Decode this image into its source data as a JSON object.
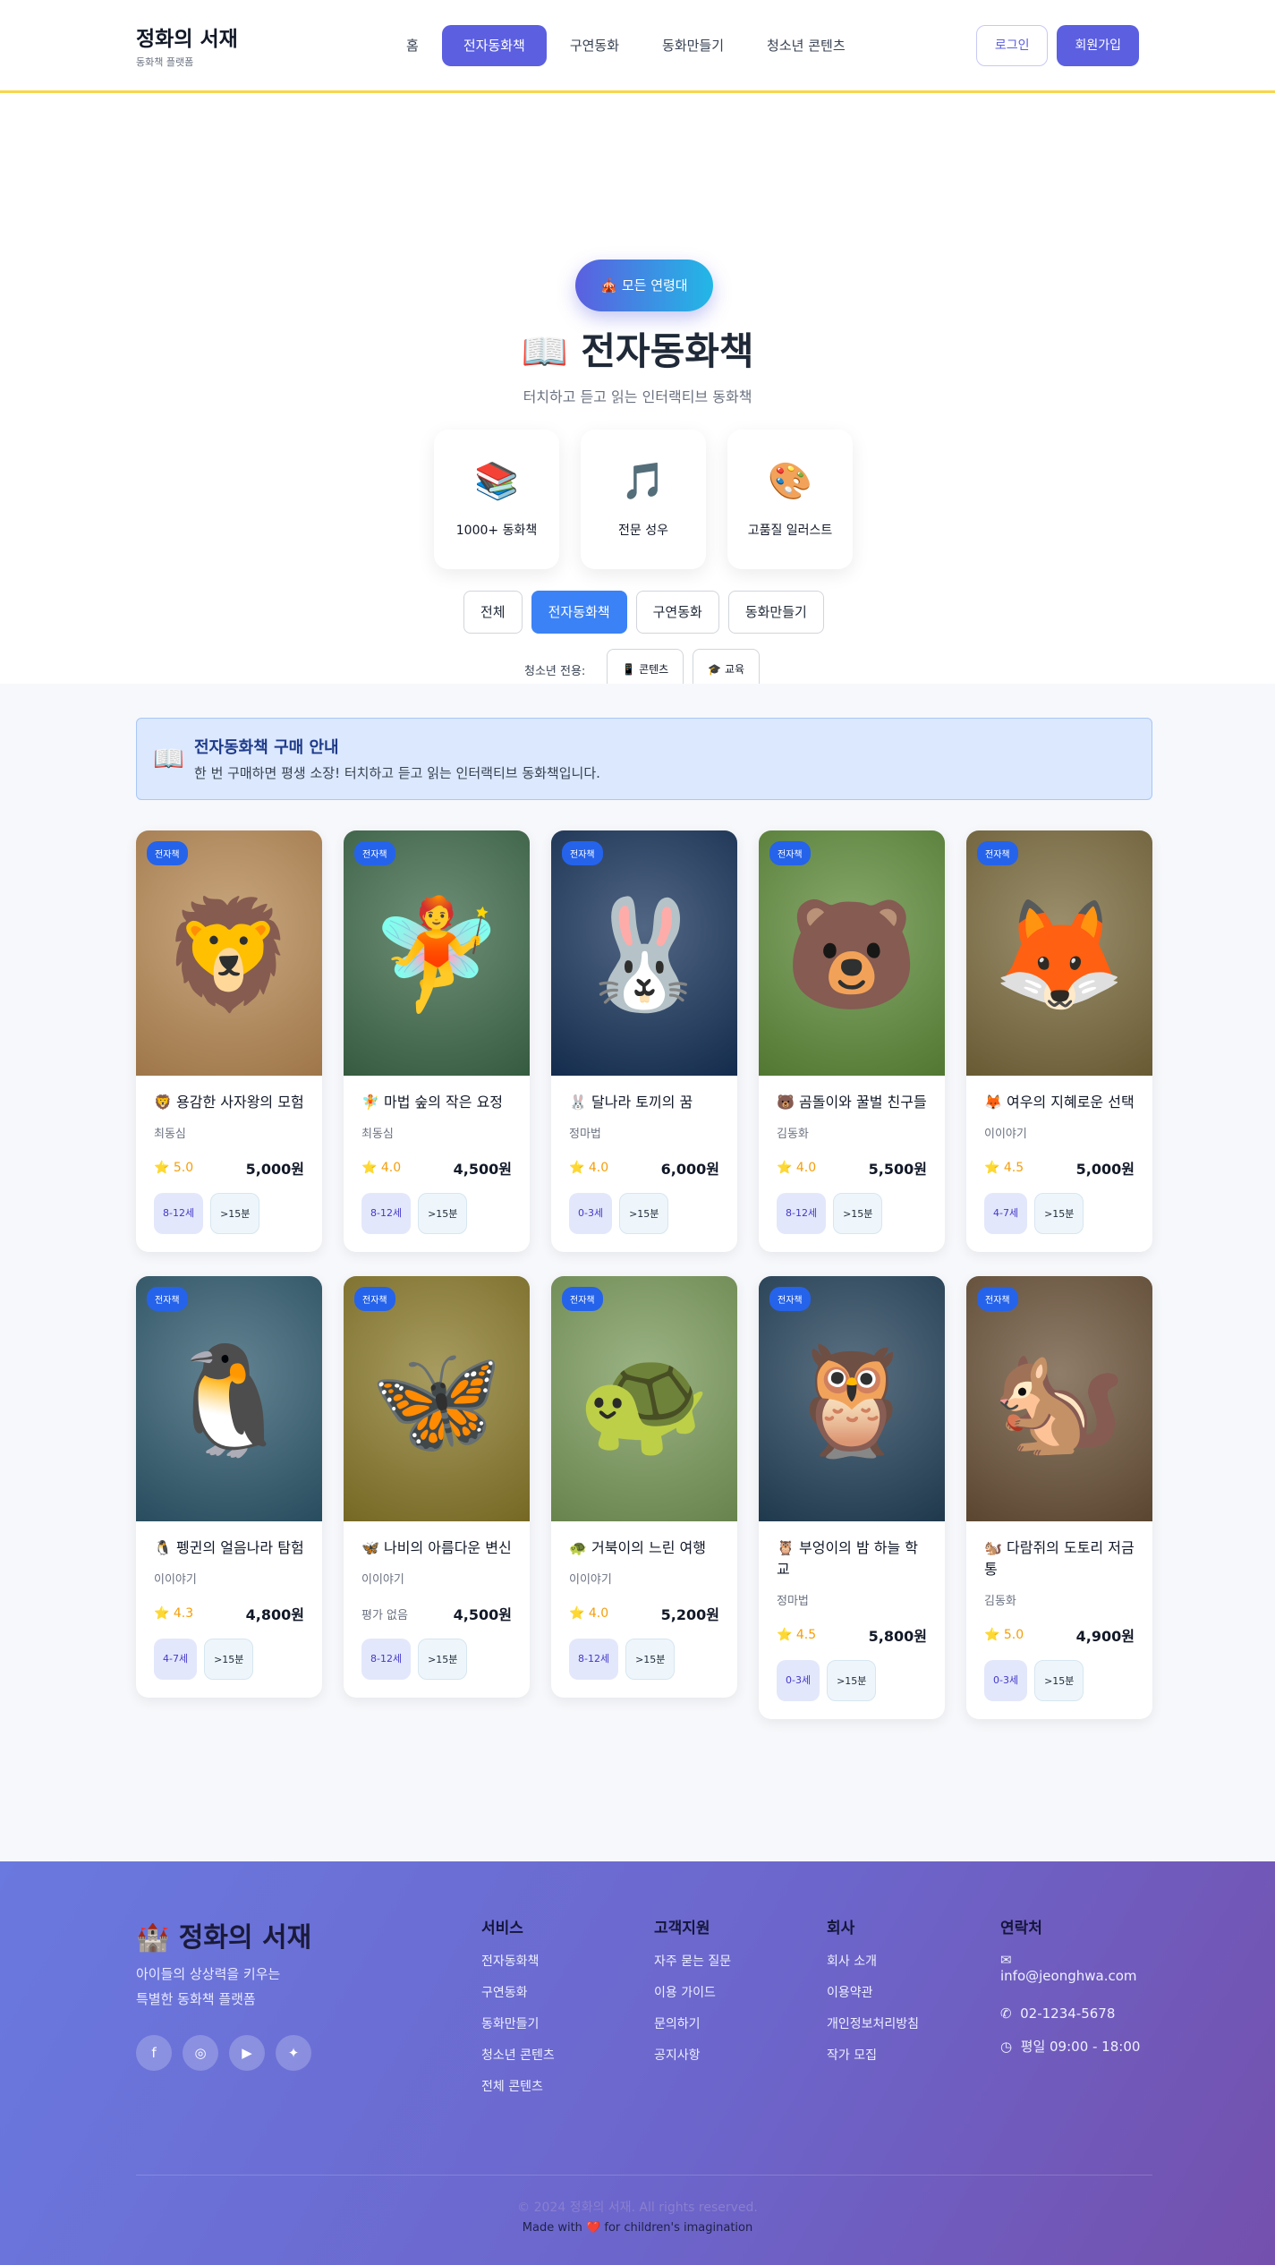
{
  "header": {
    "brand_title": "정화의 서재",
    "brand_sub": "동화책 플랫폼",
    "nav": [
      "홈",
      "전자동화책",
      "구연동화",
      "동화만들기",
      "청소년 콘텐츠"
    ],
    "login": "로그인",
    "signup": "회원가입"
  },
  "hero": {
    "age_pill": "🎪 모든 연령대",
    "title": "📖 전자동화책",
    "subtitle": "터치하고 듣고 읽는 인터랙티브 동화책",
    "features": [
      {
        "icon": "📚",
        "label": "1000+ 동화책"
      },
      {
        "icon": "🎵",
        "label": "전문 성우"
      },
      {
        "icon": "🎨",
        "label": "고품질 일러스트"
      }
    ],
    "filters": [
      "전체",
      "전자동화책",
      "구연동화",
      "동화만들기"
    ],
    "youth_label": "청소년 전용:",
    "youth_buttons": [
      "📱 콘텐츠",
      "🎓 교육"
    ]
  },
  "notice": {
    "icon": "📖",
    "title": "전자동화책 구매 안내",
    "text": "한 번 구매하면 평생 소장! 터치하고 듣고 읽는 인터랙티브 동화책입니다."
  },
  "books": [
    {
      "badge": "전자책",
      "art": "🦁",
      "title": "🦁 용감한 사자왕의 모험",
      "author": "최동심",
      "rating": "⭐ 5.0",
      "price": "5,000원",
      "age": "8-12세",
      "time": ">15분",
      "bg": "#b98a55"
    },
    {
      "badge": "전자책",
      "art": "🧚",
      "title": "🧚 마법 숲의 작은 요정",
      "author": "최동심",
      "rating": "⭐ 4.0",
      "price": "4,500원",
      "age": "8-12세",
      "time": ">15분",
      "bg": "#3e6a4a"
    },
    {
      "badge": "전자책",
      "art": "🐰",
      "title": "🐰 달나라 토끼의 꿈",
      "author": "정마법",
      "rating": "⭐ 4.0",
      "price": "6,000원",
      "age": "0-3세",
      "time": ">15분",
      "bg": "#17335a"
    },
    {
      "badge": "전자책",
      "art": "🐻",
      "title": "🐻 곰돌이와 꿀벌 친구들",
      "author": "김동화",
      "rating": "⭐ 4.0",
      "price": "5,500원",
      "age": "8-12세",
      "time": ">15분",
      "bg": "#5f8c3a"
    },
    {
      "badge": "전자책",
      "art": "🦊",
      "title": "🦊 여우의 지혜로운 선택",
      "author": "이이야기",
      "rating": "⭐ 4.5",
      "price": "5,000원",
      "age": "4-7세",
      "time": ">15분",
      "bg": "#7a6a3c"
    },
    {
      "badge": "전자책",
      "art": "🐧",
      "title": "🐧 펭귄의 얼음나라 탐험",
      "author": "이이야기",
      "rating": "⭐ 4.3",
      "price": "4,800원",
      "age": "4-7세",
      "time": ">15분",
      "bg": "#2f5a6e"
    },
    {
      "badge": "전자책",
      "art": "🦋",
      "title": "🦋 나비의 아름다운 변신",
      "author": "이이야기",
      "rating": "평가 없음",
      "price": "4,500원",
      "age": "8-12세",
      "time": ">15분",
      "bg": "#8a7a2a"
    },
    {
      "badge": "전자책",
      "art": "🐢",
      "title": "🐢 거북이의 느린 여행",
      "author": "이이야기",
      "rating": "⭐ 4.0",
      "price": "5,200원",
      "age": "8-12세",
      "time": ">15분",
      "bg": "#7a9a5a"
    },
    {
      "badge": "전자책",
      "art": "🦉",
      "title": "🦉 부엉이의 밤 하늘 학교",
      "author": "정마법",
      "rating": "⭐ 4.5",
      "price": "5,800원",
      "age": "0-3세",
      "time": ">15분",
      "bg": "#24425a"
    },
    {
      "badge": "전자책",
      "art": "🐿️",
      "title": "🐿️ 다람쥐의 도토리 저금통",
      "author": "김동화",
      "rating": "⭐ 5.0",
      "price": "4,900원",
      "age": "0-3세",
      "time": ">15분",
      "bg": "#6a5238"
    }
  ],
  "footer": {
    "brand": "🏰 정화의 서재",
    "desc_1": "아이들의 상상력을 키우는",
    "desc_2": "특별한 동화책 플랫폼",
    "socials": [
      "facebook-icon",
      "instagram-icon",
      "youtube-icon",
      "twitter-icon"
    ],
    "service_title": "서비스",
    "service_links": [
      "전자동화책",
      "구연동화",
      "동화만들기",
      "청소년 콘텐츠",
      "전체 콘텐츠"
    ],
    "support_title": "고객지원",
    "support_links": [
      "자주 묻는 질문",
      "이용 가이드",
      "문의하기",
      "공지사항"
    ],
    "company_title": "회사",
    "company_links": [
      "회사 소개",
      "이용약관",
      "개인정보처리방침",
      "작가 모집"
    ],
    "contact_title": "연락처",
    "email": "info@jeonghwa.com",
    "phone": "02-1234-5678",
    "hours": "평일 09:00 - 18:00",
    "copyright": "© 2024 정화의 서재. All rights reserved.",
    "made_with": "Made with ❤️ for children's imagination"
  }
}
